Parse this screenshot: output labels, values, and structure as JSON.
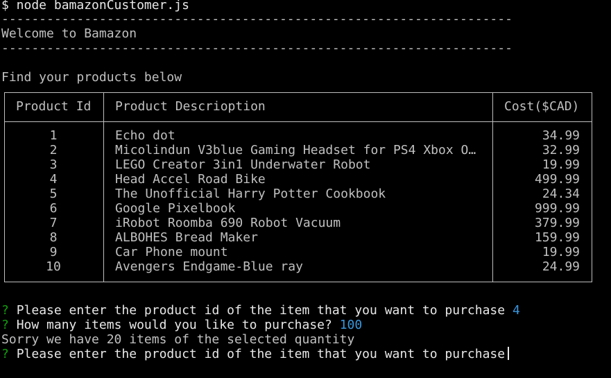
{
  "terminal": {
    "command": "$ node bamazonCustomer.js",
    "rule": "--------------------------------------------------------------------",
    "welcome": "Welcome to Bamazon",
    "find_label": "Find your products below"
  },
  "table": {
    "headers": [
      "Product Id",
      "Product Descrioption",
      "Cost($CAD)"
    ],
    "rows": [
      {
        "id": "1",
        "desc": "Echo dot",
        "cost": "34.99"
      },
      {
        "id": "2",
        "desc": "Micolindun V3blue Gaming Headset for PS4 Xbox O…",
        "cost": "32.99"
      },
      {
        "id": "3",
        "desc": "LEGO Creator 3in1 Underwater Robot",
        "cost": "19.99"
      },
      {
        "id": "4",
        "desc": "Head Accel Road Bike",
        "cost": "499.99"
      },
      {
        "id": "5",
        "desc": "The Unofficial Harry Potter Cookbook",
        "cost": "24.34"
      },
      {
        "id": "6",
        "desc": "Google Pixelbook",
        "cost": "999.99"
      },
      {
        "id": "7",
        "desc": "iRobot Roomba 690 Robot Vacuum",
        "cost": "379.99"
      },
      {
        "id": "8",
        "desc": "ALBOHES Bread Maker",
        "cost": "159.99"
      },
      {
        "id": "9",
        "desc": "Car Phone mount",
        "cost": "19.99"
      },
      {
        "id": "10",
        "desc": "Avengers Endgame-Blue ray",
        "cost": "24.99"
      }
    ]
  },
  "prompts": {
    "marker": "?",
    "q1": "Please enter the product id of the item that you want to purchase",
    "a1": "4",
    "q2": "How many items would you like to purchase?",
    "a2": "100",
    "error": "Sorry we have 20 items of the selected quantity",
    "q3": "Please enter the product id of the item that you want to purchase"
  },
  "colors": {
    "background": "#000000",
    "text": "#c0c0c0",
    "prompt_marker": "#13a10e",
    "answer": "#3a96dd"
  }
}
